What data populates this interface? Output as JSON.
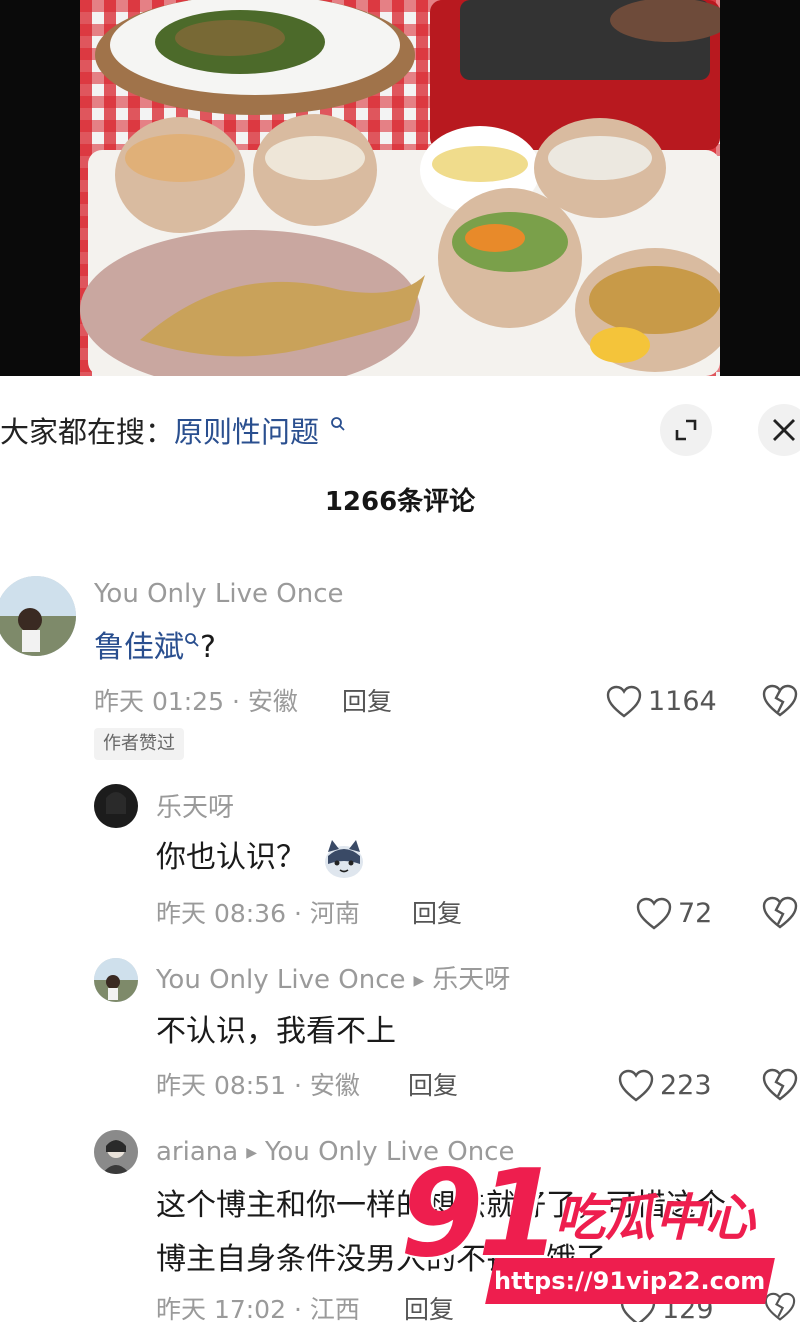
{
  "search": {
    "prefix": "大家都在搜：",
    "query": "原则性问题"
  },
  "comments_header": {
    "title": "1266条评论"
  },
  "comments": [
    {
      "user": "You Only Live Once",
      "text_link": "鲁佳斌",
      "text_suffix": "?",
      "time_location": "昨天 01:25 · 安徽",
      "reply_label": "回复",
      "likes": "1164",
      "badge": "作者赞过"
    },
    {
      "user": "乐天呀",
      "text": "你也认识？",
      "time_location": "昨天 08:36 · 河南",
      "reply_label": "回复",
      "likes": "72"
    },
    {
      "user": "You Only Live Once",
      "reply_to": "乐天呀",
      "text": "不认识，我看不上",
      "time_location": "昨天 08:51 · 安徽",
      "reply_label": "回复",
      "likes": "223"
    },
    {
      "user": "ariana",
      "reply_to": "You Only Live Once",
      "text_line1": "这个博主和你一样的想法就好了，可惜这个",
      "text_line2": "博主自身条件没男人的不错就饿了",
      "time_location": "昨天 17:02 · 江西",
      "reply_label": "回复",
      "likes": "129"
    }
  ],
  "watermark": {
    "number": "91",
    "name": "吃瓜中心",
    "url": "https://91vip22.com"
  },
  "colors": {
    "link": "#2a4f8f",
    "watermark": "#ee1e4e",
    "muted": "#9a9a9a"
  }
}
